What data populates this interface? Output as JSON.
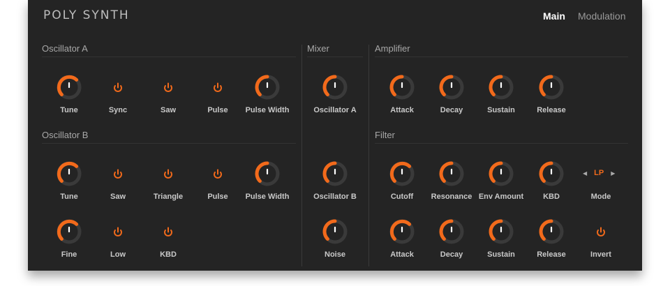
{
  "app": {
    "title": "POLY SYNTH"
  },
  "tabs": [
    {
      "label": "Main",
      "active": true
    },
    {
      "label": "Modulation",
      "active": false
    }
  ],
  "sections": {
    "osc_a": "Oscillator A",
    "osc_b": "Oscillator B",
    "mixer": "Mixer",
    "amplifier": "Amplifier",
    "filter": "Filter"
  },
  "osc_a": {
    "tune": "Tune",
    "sync": "Sync",
    "saw": "Saw",
    "pulse": "Pulse",
    "pulse_width": "Pulse Width"
  },
  "osc_b": {
    "tune": "Tune",
    "saw": "Saw",
    "triangle": "Triangle",
    "pulse": "Pulse",
    "pulse_width": "Pulse Width",
    "fine": "Fine",
    "low": "Low",
    "kbd": "KBD"
  },
  "mixer": {
    "osc_a": "Oscillator A",
    "osc_b": "Oscillator B",
    "noise": "Noise"
  },
  "amplifier": {
    "attack": "Attack",
    "decay": "Decay",
    "sustain": "Sustain",
    "release": "Release"
  },
  "filter": {
    "cutoff": "Cutoff",
    "resonance": "Resonance",
    "env_amount": "Env Amount",
    "kbd": "KBD",
    "mode_value": "LP",
    "mode_label": "Mode",
    "attack": "Attack",
    "decay": "Decay",
    "sustain": "Sustain",
    "release": "Release",
    "invert": "Invert"
  },
  "colors": {
    "accent": "#f26a1b",
    "background": "#242424",
    "track": "#3a3a3a"
  }
}
